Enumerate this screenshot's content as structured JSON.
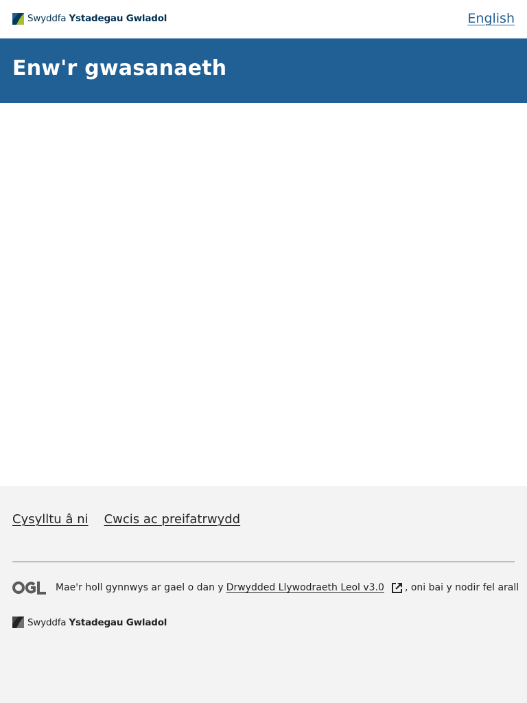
{
  "header": {
    "logo": {
      "icon": "ons-logo-mark-icon",
      "text_light": "Swyddfa ",
      "text_bold": "Ystadegau Gwladol",
      "color": "#003151"
    },
    "language_link": "English"
  },
  "banner": {
    "service_name": "Enw'r gwasanaeth",
    "background": "#206095"
  },
  "footer": {
    "background": "#f3f3f3",
    "links": [
      {
        "label": "Cysylltu â ni"
      },
      {
        "label": "Cwcis ac preifatrwydd"
      }
    ],
    "licence": {
      "logo_icon": "ogl-logo-icon",
      "text_before": "Mae'r holl gynnwys ar gael o dan y",
      "link_label": "Drwydded Llywodraeth Leol v3.0",
      "external_icon": "external-link-icon",
      "text_after": ", oni bai y nodir fel arall"
    },
    "logo": {
      "icon": "ons-logo-mark-icon",
      "text_light": "Swyddfa ",
      "text_bold": "Ystadegau Gwladol"
    }
  }
}
